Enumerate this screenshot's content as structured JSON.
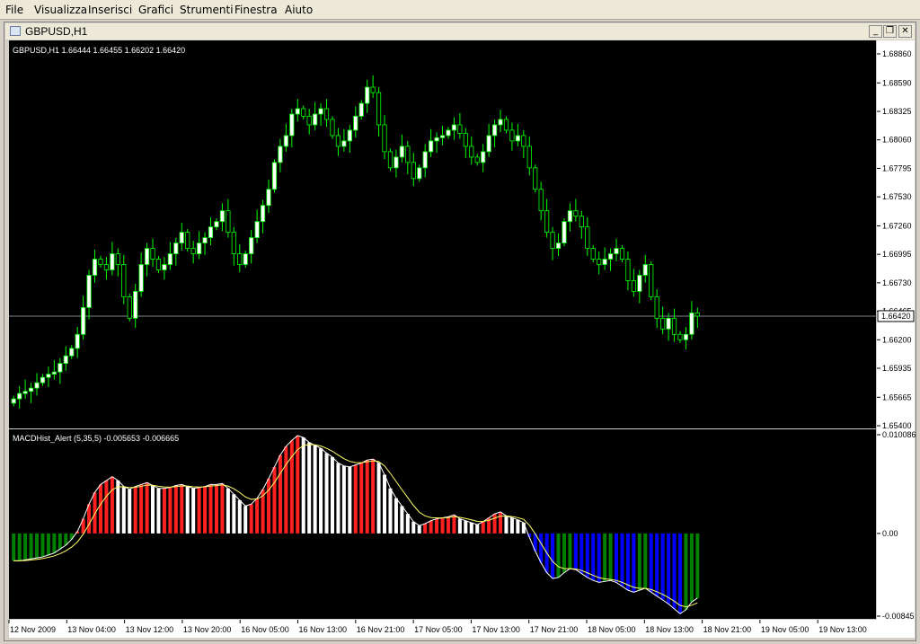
{
  "menubar": {
    "items": [
      "File",
      "Visualizza",
      "Inserisci",
      "Grafici",
      "Strumenti",
      "Finestra",
      "Aiuto"
    ]
  },
  "window": {
    "title": "GBPUSD,H1",
    "buttons": {
      "minimize": "_",
      "restore": "❐",
      "close": "✕"
    }
  },
  "main_chart": {
    "header": "GBPUSD,H1  1.66444 1.66455 1.66202 1.66420",
    "price_ticks": [
      "1.68860",
      "1.68590",
      "1.68325",
      "1.68060",
      "1.67795",
      "1.67530",
      "1.67260",
      "1.66995",
      "1.66730",
      "1.66465",
      "1.66200",
      "1.65935",
      "1.65665",
      "1.65400"
    ],
    "current_price": "1.66420"
  },
  "indicator": {
    "header": "MACDHist_Alert (5,35,5)  -0.005653 -0.006665",
    "ticks": [
      "0.010086",
      "0.00",
      "-0.00845"
    ]
  },
  "time_axis": {
    "labels": [
      "12 Nov 2009",
      "13 Nov 04:00",
      "13 Nov 12:00",
      "13 Nov 20:00",
      "16 Nov 05:00",
      "16 Nov 13:00",
      "16 Nov 21:00",
      "17 Nov 05:00",
      "17 Nov 13:00",
      "17 Nov 21:00",
      "18 Nov 05:00",
      "18 Nov 13:00",
      "18 Nov 21:00",
      "19 Nov 05:00",
      "19 Nov 13:00"
    ]
  },
  "colors": {
    "background": "#000000",
    "candle": "#00ff00",
    "bull_body": "#ffffff",
    "bear_body": "#000000",
    "macd_up": "#ff2020",
    "macd_down": "#ffffff",
    "macd_neg_a": "#0000ff",
    "macd_neg_b": "#008000",
    "price_line": "#778899",
    "macd_line": "#ffffff",
    "signal_line": "#ffff66"
  },
  "chart_data": [
    {
      "type": "candlestick",
      "title": "GBPUSD,H1",
      "ylim": [
        1.654,
        1.6886
      ],
      "close_series": [
        1.6565,
        1.657,
        1.6572,
        1.6575,
        1.658,
        1.6585,
        1.6588,
        1.659,
        1.6598,
        1.6605,
        1.6612,
        1.6625,
        1.665,
        1.668,
        1.6695,
        1.669,
        1.6685,
        1.67,
        1.669,
        1.666,
        1.664,
        1.6665,
        1.669,
        1.6705,
        1.6695,
        1.6685,
        1.669,
        1.67,
        1.671,
        1.672,
        1.6705,
        1.67,
        1.671,
        1.6715,
        1.6725,
        1.673,
        1.674,
        1.672,
        1.67,
        1.669,
        1.67,
        1.6715,
        1.673,
        1.6745,
        1.676,
        1.6785,
        1.68,
        1.681,
        1.683,
        1.6835,
        1.6828,
        1.682,
        1.683,
        1.6835,
        1.6825,
        1.681,
        1.68,
        1.6805,
        1.6815,
        1.6828,
        1.684,
        1.6855,
        1.685,
        1.682,
        1.6795,
        1.678,
        1.679,
        1.68,
        1.6785,
        1.677,
        1.678,
        1.6795,
        1.6805,
        1.6808,
        1.681,
        1.6815,
        1.682,
        1.6812,
        1.68,
        1.679,
        1.6785,
        1.6795,
        1.681,
        1.682,
        1.6825,
        1.6815,
        1.6805,
        1.681,
        1.68,
        1.678,
        1.676,
        1.674,
        1.672,
        1.6705,
        1.671,
        1.673,
        1.674,
        1.6735,
        1.6725,
        1.6705,
        1.6695,
        1.669,
        1.6695,
        1.67,
        1.6705,
        1.6695,
        1.6675,
        1.6665,
        1.668,
        1.669,
        1.666,
        1.664,
        1.663,
        1.664,
        1.6625,
        1.662,
        1.6625,
        1.6645,
        1.6642
      ],
      "macd_values": [
        -0.0028,
        -0.0028,
        -0.0027,
        -0.0026,
        -0.0025,
        -0.0024,
        -0.0022,
        -0.002,
        -0.0016,
        -0.0012,
        -0.0006,
        0.0002,
        0.0015,
        0.003,
        0.0042,
        0.005,
        0.0054,
        0.0058,
        0.0054,
        0.0048,
        0.0045,
        0.0048,
        0.005,
        0.0052,
        0.0049,
        0.0046,
        0.0046,
        0.0047,
        0.0049,
        0.005,
        0.0048,
        0.0046,
        0.0047,
        0.0048,
        0.005,
        0.005,
        0.0051,
        0.0046,
        0.004,
        0.0034,
        0.0028,
        0.003,
        0.0036,
        0.0045,
        0.0056,
        0.0068,
        0.008,
        0.0089,
        0.0095,
        0.01,
        0.0098,
        0.0093,
        0.009,
        0.0087,
        0.0082,
        0.0078,
        0.0072,
        0.0069,
        0.0068,
        0.007,
        0.0072,
        0.0075,
        0.0076,
        0.0072,
        0.006,
        0.0046,
        0.0036,
        0.0028,
        0.002,
        0.0012,
        0.0008,
        0.001,
        0.0013,
        0.0015,
        0.0016,
        0.0017,
        0.0019,
        0.0015,
        0.0013,
        0.0011,
        0.0009,
        0.0012,
        0.0016,
        0.002,
        0.0022,
        0.0018,
        0.0016,
        0.0014,
        0.0011,
        -0.0004,
        -0.0018,
        -0.003,
        -0.004,
        -0.0046,
        -0.0045,
        -0.004,
        -0.0036,
        -0.0037,
        -0.0041,
        -0.0045,
        -0.0048,
        -0.005,
        -0.0049,
        -0.0048,
        -0.005,
        -0.0054,
        -0.0058,
        -0.006,
        -0.0058,
        -0.0056,
        -0.006,
        -0.0064,
        -0.0068,
        -0.0072,
        -0.0077,
        -0.0082,
        -0.0078,
        -0.007,
        -0.0066
      ]
    }
  ]
}
